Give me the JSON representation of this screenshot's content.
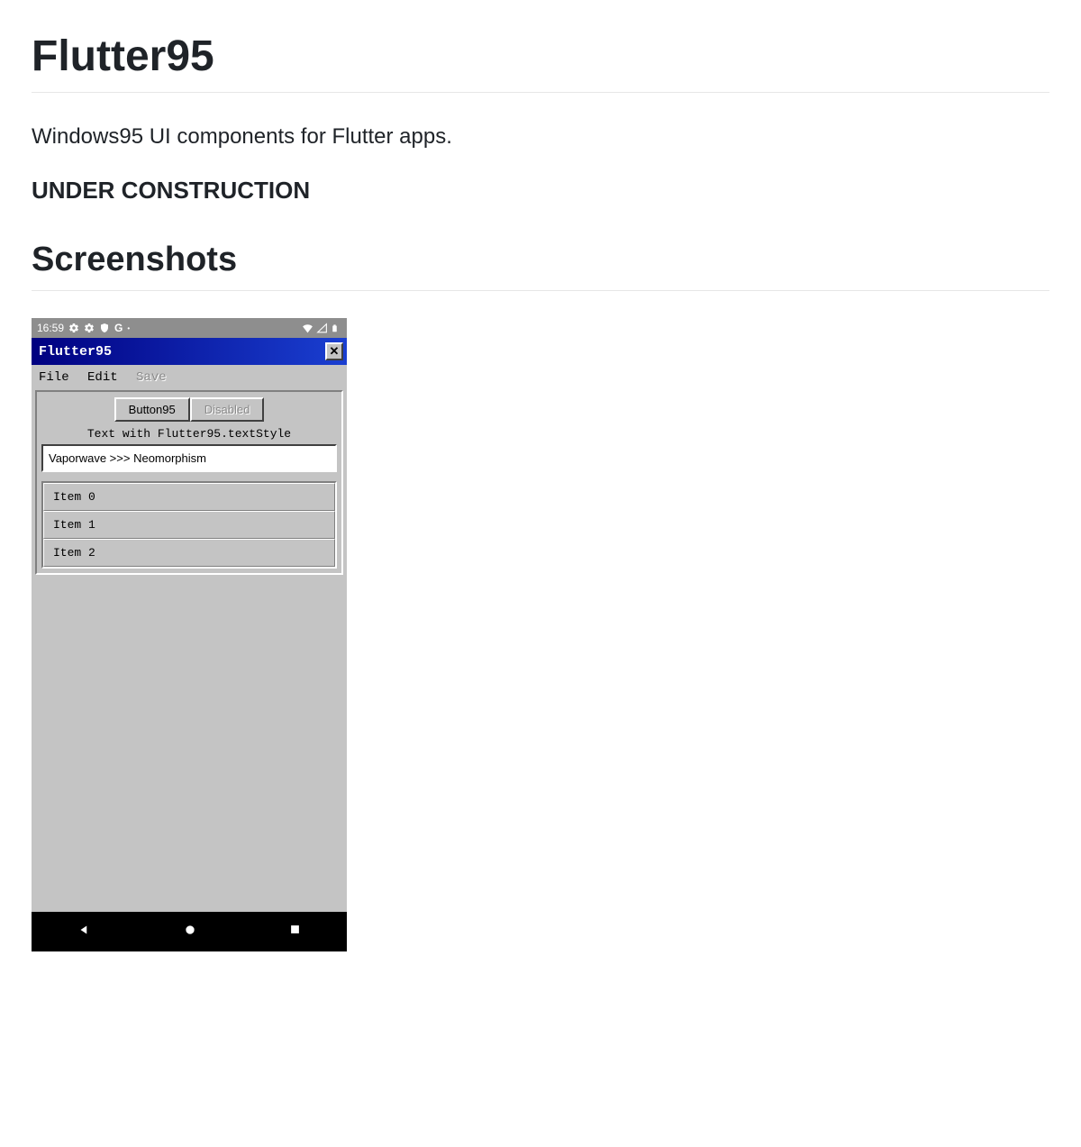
{
  "page": {
    "title": "Flutter95",
    "tagline": "Windows95 UI components for Flutter apps.",
    "under_construction": "UNDER CONSTRUCTION",
    "screenshots_heading": "Screenshots"
  },
  "phone": {
    "status": {
      "time": "16:59"
    },
    "win": {
      "title": "Flutter95",
      "close": "✕",
      "menu": {
        "file": "File",
        "edit": "Edit",
        "save": "Save"
      },
      "buttons": {
        "primary": "Button95",
        "disabled": "Disabled"
      },
      "text_style_line": "Text with Flutter95.textStyle",
      "text_field": "Vaporwave >>> Neomorphism",
      "items": [
        "Item 0",
        "Item 1",
        "Item 2"
      ]
    }
  }
}
